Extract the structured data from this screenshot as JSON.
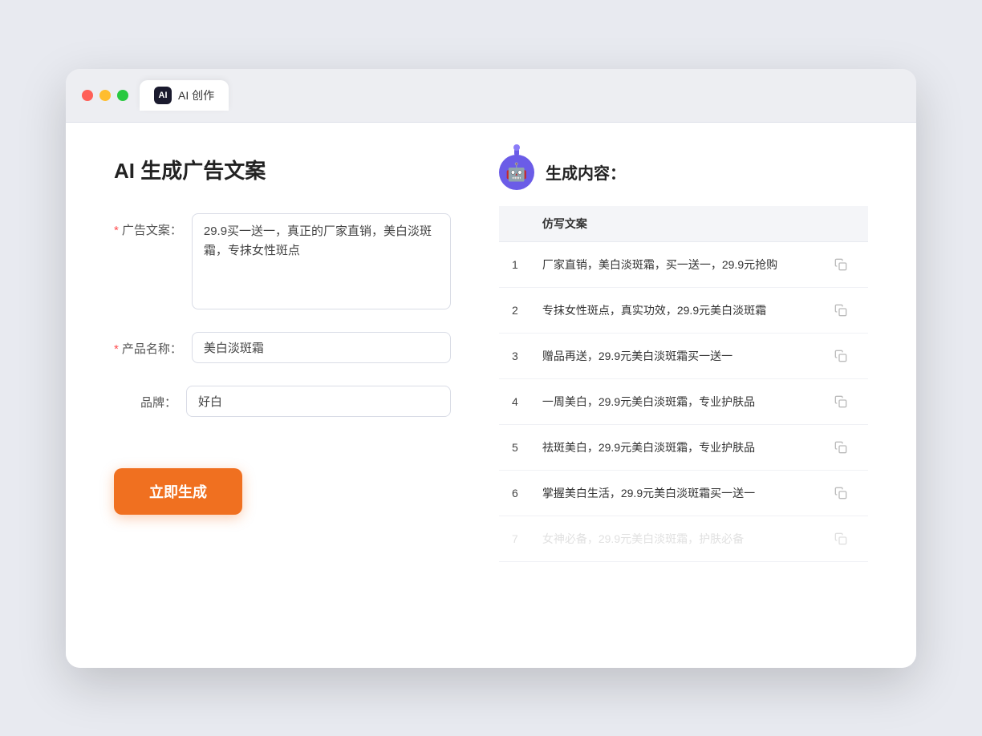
{
  "browser": {
    "tab_label": "AI 创作",
    "traffic_lights": [
      "red",
      "yellow",
      "green"
    ]
  },
  "page": {
    "title": "AI 生成广告文案",
    "right_title": "生成内容："
  },
  "form": {
    "ad_copy_label": "广告文案：",
    "ad_copy_required": "*",
    "ad_copy_value": "29.9买一送一，真正的厂家直销，美白淡斑霜，专抹女性斑点",
    "product_name_label": "产品名称：",
    "product_name_required": "*",
    "product_name_value": "美白淡斑霜",
    "brand_label": "品牌：",
    "brand_value": "好白",
    "generate_button": "立即生成"
  },
  "results": {
    "column_header": "仿写文案",
    "items": [
      {
        "id": 1,
        "text": "厂家直销，美白淡斑霜，买一送一，29.9元抢购"
      },
      {
        "id": 2,
        "text": "专抹女性斑点，真实功效，29.9元美白淡斑霜"
      },
      {
        "id": 3,
        "text": "赠品再送，29.9元美白淡斑霜买一送一"
      },
      {
        "id": 4,
        "text": "一周美白，29.9元美白淡斑霜，专业护肤品"
      },
      {
        "id": 5,
        "text": "祛斑美白，29.9元美白淡斑霜，专业护肤品"
      },
      {
        "id": 6,
        "text": "掌握美白生活，29.9元美白淡斑霜买一送一"
      },
      {
        "id": 7,
        "text": "女神必备，29.9元美白淡斑霜，护肤必备",
        "faded": true
      }
    ]
  }
}
